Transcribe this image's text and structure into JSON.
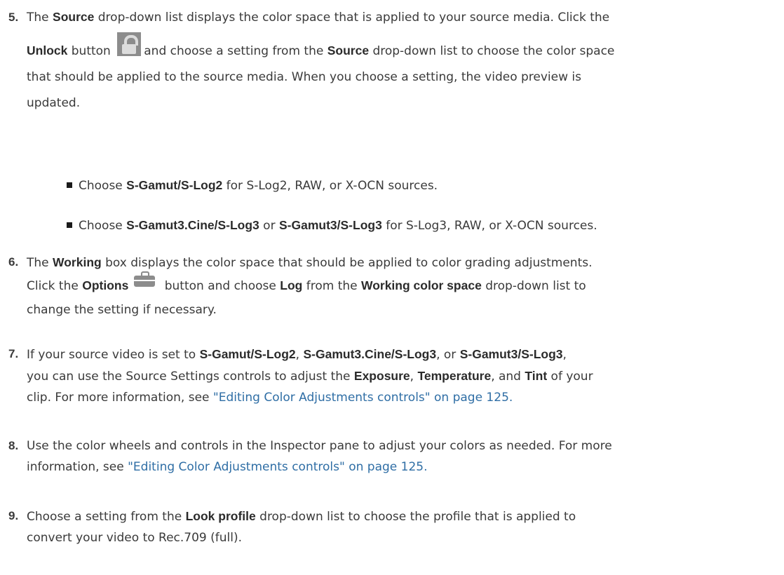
{
  "steps": {
    "s5": {
      "num": "5.",
      "t1": "The ",
      "b1": "Source",
      "t2": " drop-down list displays the color space that is applied to your source media. Click the",
      "b2": "Unlock",
      "t3": " button ",
      "t4": "and choose a setting from the ",
      "b3": "Source",
      "t5": " drop-down list to choose the color space",
      "t6": "that should be applied to the source media. When you choose a setting, the video preview is",
      "t7": "updated."
    },
    "bullets": [
      {
        "t1": "Choose ",
        "b1": "S-Gamut/S-Log2",
        "t2": " for S-Log2, RAW, or X-OCN sources."
      },
      {
        "t1": "Choose ",
        "b1": "S-Gamut3.Cine/S-Log3",
        "t2": " or ",
        "b2": "S-Gamut3/S-Log3",
        "t3": " for S-Log3, RAW, or X-OCN sources."
      }
    ],
    "s6": {
      "num": "6.",
      "t1": "The ",
      "b1": "Working",
      "t2": " box displays the color space that should be applied to color grading adjustments.",
      "t3": "Click the ",
      "b2": "Options",
      "t4": " button and choose ",
      "b3": "Log",
      "t5": " from the ",
      "b4": "Working color space",
      "t6": " drop-down list to",
      "t7": "change the setting if necessary."
    },
    "s7": {
      "num": "7.",
      "t1": "If your source video is set to ",
      "b1": "S-Gamut/S-Log2",
      "t2": ", ",
      "b2": "S-Gamut3.Cine/S-Log3",
      "t3": ", or ",
      "b3": "S-Gamut3/S-Log3",
      "t4": ",",
      "t5": "you can use the Source Settings controls to adjust the ",
      "b4": "Exposure",
      "t6": ", ",
      "b5": "Temperature",
      "t7": ", and ",
      "b6": "Tint",
      "t8": " of your",
      "t9": "clip. For more information, see ",
      "link": "\"Editing Color Adjustments controls\" on page 125."
    },
    "s8": {
      "num": "8.",
      "t1": "Use the color wheels and controls in the Inspector pane to adjust your colors as needed. For more",
      "t2": "information, see ",
      "link": "\"Editing Color Adjustments controls\" on page 125."
    },
    "s9": {
      "num": "9.",
      "t1": "Choose a setting from the ",
      "b1": "Look profile",
      "t2": " drop-down list to choose the profile that is applied to",
      "t3": "convert your video to Rec.709 (full)."
    }
  },
  "icons": {
    "unlock": "lock-icon",
    "options": "toolbox-icon"
  },
  "colors": {
    "text": "#3a3a3a",
    "link": "#2f6ea5",
    "icon": "#8c8c8c"
  }
}
